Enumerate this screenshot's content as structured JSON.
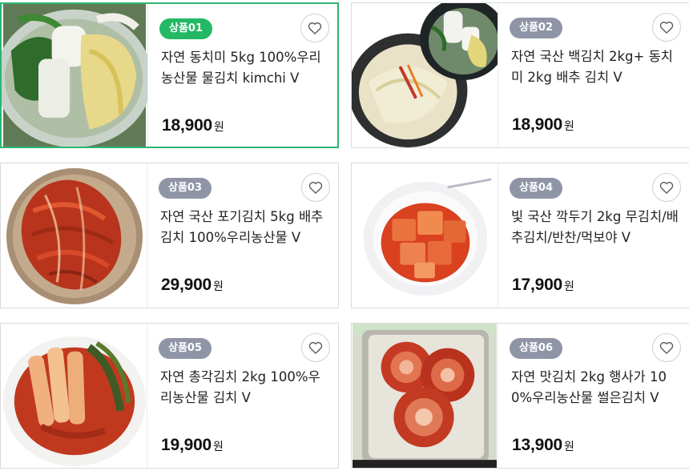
{
  "products": [
    {
      "badge": "상품01",
      "title": "자연 동치미 5kg 100%우리농산물 물김치 kimchi V",
      "price": "18,900",
      "currency": "원",
      "badge_color": "#22b864",
      "selected": true,
      "image": "dongchimi-icon"
    },
    {
      "badge": "상품02",
      "title": "자연 국산 백김치 2kg+ 동치미 2kg 배추 김치 V",
      "price": "18,900",
      "currency": "원",
      "badge_color": "#8f95a6",
      "selected": false,
      "image": "baek-kimchi-icon"
    },
    {
      "badge": "상품03",
      "title": "자연 국산 포기김치 5kg 배추 김치 100%우리농산물 V",
      "price": "29,900",
      "currency": "원",
      "badge_color": "#8f95a6",
      "selected": false,
      "image": "pogi-kimchi-icon"
    },
    {
      "badge": "상품04",
      "title": "빛 국산 깍두기 2kg 무김치/배추김치/반찬/먹보야 V",
      "price": "17,900",
      "currency": "원",
      "badge_color": "#8f95a6",
      "selected": false,
      "image": "kkakdugi-icon"
    },
    {
      "badge": "상품05",
      "title": "자연 총각김치 2kg 100%우리농산물 김치 V",
      "price": "19,900",
      "currency": "원",
      "badge_color": "#8f95a6",
      "selected": false,
      "image": "chonggak-kimchi-icon"
    },
    {
      "badge": "상품06",
      "title": "자연 맛김치 2kg 행사가 100%우리농산물 썰은김치 V",
      "price": "13,900",
      "currency": "원",
      "badge_color": "#8f95a6",
      "selected": false,
      "image": "mat-kimchi-icon"
    }
  ],
  "wishlist_icon": "heart-outline-icon"
}
